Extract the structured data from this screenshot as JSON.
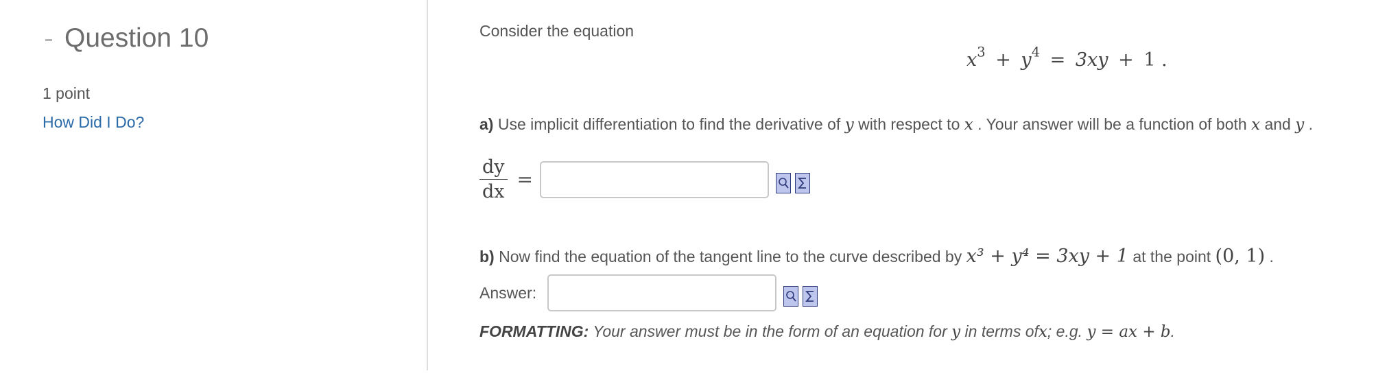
{
  "question": {
    "title": "Question 10",
    "points": "1 point",
    "how_did_i_do": "How Did I Do?"
  },
  "problem": {
    "intro": "Consider the equation",
    "equation": {
      "x": "x",
      "x_exp": "3",
      "plus": "+",
      "y": "y",
      "y_exp": "4",
      "equals": "=",
      "rhs": "3xy",
      "plus2": "+",
      "const": "1",
      "period": "."
    },
    "part_a": {
      "label": "a)",
      "text_1": "Use implicit differentiation to find the derivative of",
      "var_y": "y",
      "text_2": "with respect to",
      "var_x": "x",
      "text_3": ". Your answer will be a function of both",
      "var_x2": "x",
      "text_4": "and",
      "var_y2": "y",
      "text_5": "."
    },
    "derivative": {
      "numerator": "dy",
      "denominator": "dx",
      "equals": "=",
      "value": ""
    },
    "part_b": {
      "label": "b)",
      "text_1": "Now find the equation of the tangent line to the curve described by",
      "eq": "x³ + y⁴ = 3xy + 1",
      "text_2": "at the point",
      "point": "(0, 1)",
      "text_3": "."
    },
    "answer": {
      "label": "Answer:",
      "value": ""
    },
    "formatting": {
      "label": "FORMATTING:",
      "text_1": "Your answer must be in the form of an equation for",
      "var_y": "y",
      "text_2": "in terms of",
      "var_x": "x",
      "text_3": "; e.g.",
      "example": "y = ax + b",
      "text_4": "."
    }
  },
  "icons": [
    "preview-icon",
    "equation-editor-icon"
  ],
  "colors": {
    "link": "#2b6ba8",
    "icon_fill": "#bfc6ee",
    "icon_border": "#2e3a7a"
  }
}
